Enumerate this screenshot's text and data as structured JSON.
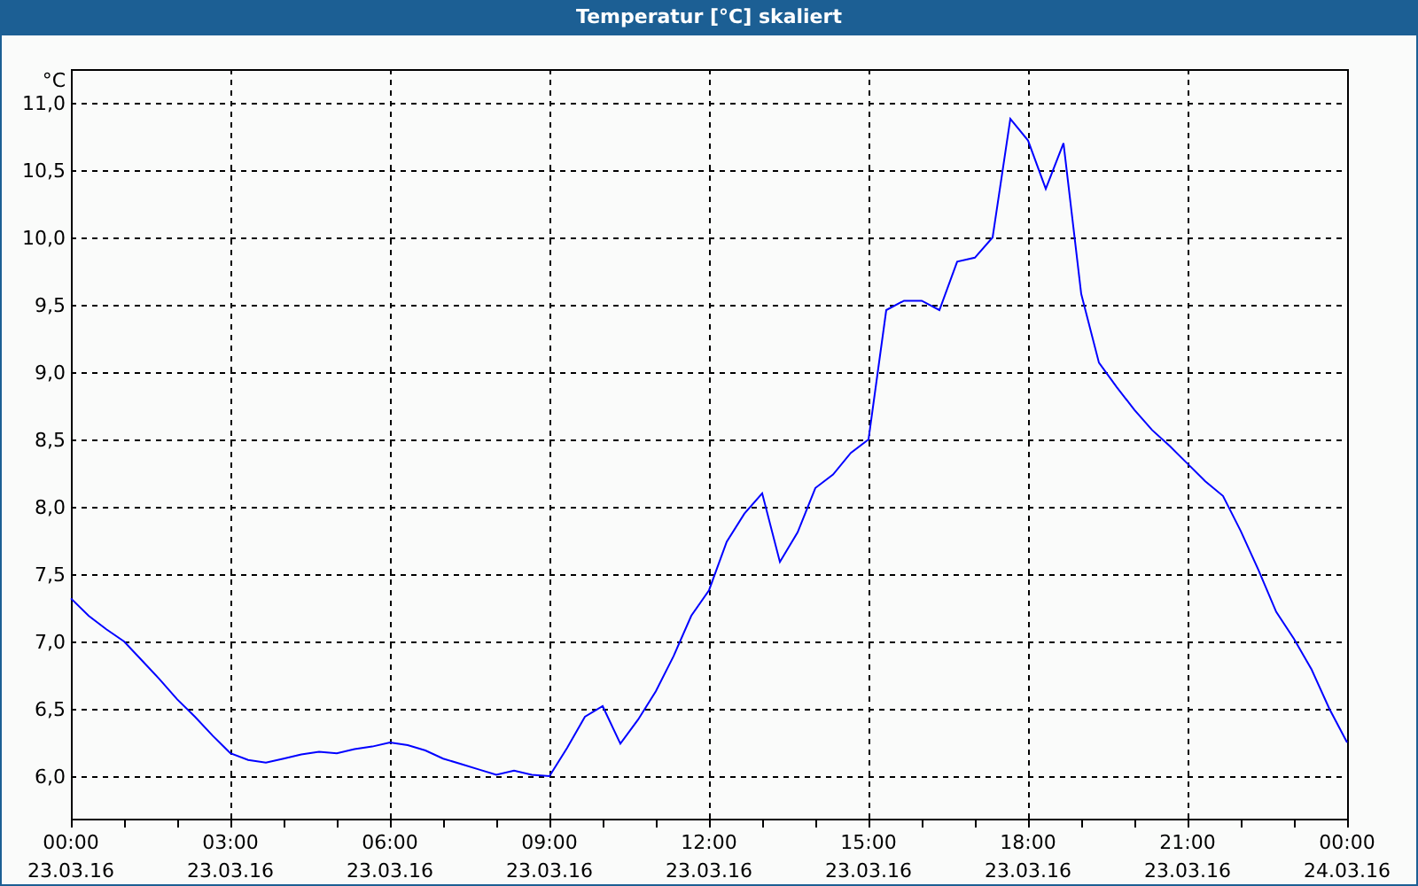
{
  "window": {
    "title": "Temperatur [°C] skaliert"
  },
  "chart": {
    "chart_data": {
      "type": "line",
      "grid": true,
      "ylabel": "°C",
      "ylim": [
        5.684,
        11.25
      ],
      "yticks": [
        {
          "value": 6,
          "label": "6,0"
        },
        {
          "value": 6.5,
          "label": "6,5"
        },
        {
          "value": 7,
          "label": "7,0"
        },
        {
          "value": 7.5,
          "label": "7,5"
        },
        {
          "value": 8,
          "label": "8,0"
        },
        {
          "value": 8.5,
          "label": "8,5"
        },
        {
          "value": 9,
          "label": "9,0"
        },
        {
          "value": 9.5,
          "label": "9,5"
        },
        {
          "value": 10,
          "label": "10,0"
        },
        {
          "value": 10.5,
          "label": "10,5"
        },
        {
          "value": 11,
          "label": "11,0"
        }
      ],
      "categories": [
        "00:00\n23.03.16",
        null,
        null,
        null,
        null,
        null,
        null,
        null,
        null,
        "03:00\n23.03.16",
        null,
        null,
        null,
        null,
        null,
        null,
        null,
        null,
        "06:00\n23.03.16",
        null,
        null,
        null,
        null,
        null,
        null,
        null,
        null,
        "09:00\n23.03.16",
        null,
        null,
        null,
        null,
        null,
        null,
        null,
        null,
        "12:00\n23.03.16",
        null,
        null,
        null,
        null,
        null,
        null,
        null,
        null,
        "15:00\n23.03.16",
        null,
        null,
        null,
        null,
        null,
        null,
        null,
        null,
        "18:00\n23.03.16",
        null,
        null,
        null,
        null,
        null,
        null,
        null,
        null,
        "21:00\n23.03.16",
        null,
        null,
        null,
        null,
        null,
        null,
        null,
        null,
        "00:00\n24.03.16"
      ],
      "series": [
        {
          "color": "#0000ff",
          "values": [
            7.32,
            7.19,
            7.09,
            7.0,
            6.86,
            6.72,
            6.57,
            6.44,
            6.3,
            6.17,
            6.12,
            6.1,
            6.13,
            6.16,
            6.18,
            6.17,
            6.2,
            6.22,
            6.25,
            6.23,
            6.19,
            6.13,
            6.09,
            6.05,
            6.01,
            6.04,
            6.01,
            6.0,
            6.21,
            6.44,
            6.52,
            6.24,
            6.42,
            6.63,
            6.89,
            7.19,
            7.38,
            7.74,
            7.95,
            8.1,
            7.59,
            7.81,
            8.14,
            8.24,
            8.4,
            8.5,
            9.46,
            9.53,
            9.53,
            9.46,
            9.82,
            9.85,
            10.0,
            10.88,
            10.72,
            10.36,
            10.7,
            9.58,
            9.07,
            8.89,
            8.72,
            8.57,
            8.45,
            8.32,
            8.19,
            8.08,
            7.82,
            7.53,
            7.22,
            7.02,
            6.79,
            6.5,
            6.25
          ]
        }
      ]
    }
  }
}
